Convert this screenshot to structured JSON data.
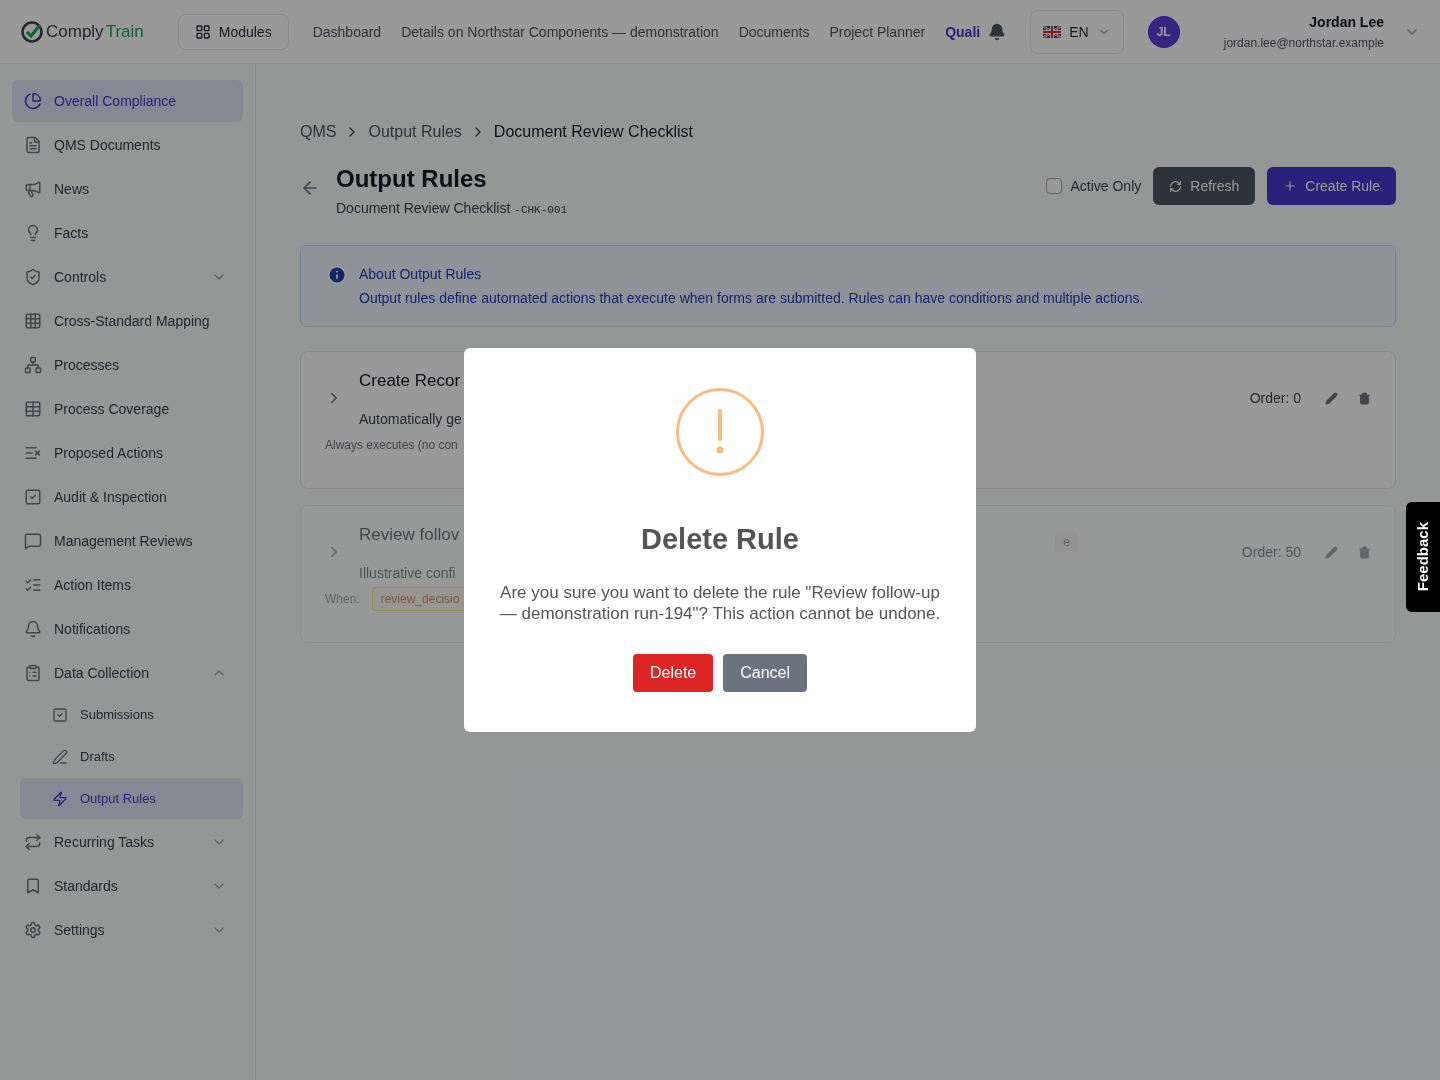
{
  "header": {
    "logo": {
      "part_1": "Comply",
      "part_2": "Train"
    },
    "modules_button": "Modules",
    "nav": [
      {
        "label": "Dashboard",
        "selected": false
      },
      {
        "label": "Details on Northstar Components — demonstration",
        "selected": false
      },
      {
        "label": "Documents",
        "selected": false
      },
      {
        "label": "Project Planner",
        "selected": false
      },
      {
        "label": "Quali",
        "selected": true
      }
    ],
    "language": "EN",
    "user": {
      "initials": "JL",
      "name": "Jordan Lee",
      "email": "jordan.lee@northstar.example"
    }
  },
  "sidebar": {
    "items": [
      {
        "label": "Overall Compliance",
        "selected": true
      },
      {
        "label": "QMS Documents",
        "selected": false
      },
      {
        "label": "News",
        "selected": false
      },
      {
        "label": "Facts",
        "selected": false
      },
      {
        "label": "Controls",
        "selected": false,
        "expanded": false
      },
      {
        "label": "Cross-Standard Mapping",
        "selected": false
      },
      {
        "label": "Processes",
        "selected": false
      },
      {
        "label": "Process Coverage",
        "selected": false
      },
      {
        "label": "Proposed Actions",
        "selected": false
      },
      {
        "label": "Audit & Inspection",
        "selected": false
      },
      {
        "label": "Management Reviews",
        "selected": false
      },
      {
        "label": "Action Items",
        "selected": false
      },
      {
        "label": "Notifications",
        "selected": false
      },
      {
        "label": "Data Collection",
        "selected": false,
        "expanded": true,
        "children": [
          {
            "label": "Submissions",
            "selected": false
          },
          {
            "label": "Drafts",
            "selected": false
          },
          {
            "label": "Output Rules",
            "selected": true
          }
        ]
      },
      {
        "label": "Recurring Tasks",
        "selected": false,
        "expanded": false
      },
      {
        "label": "Standards",
        "selected": false,
        "expanded": false
      },
      {
        "label": "Settings",
        "selected": false,
        "expanded": false
      }
    ]
  },
  "breadcrumb": [
    "QMS",
    "Output Rules",
    "Document Review Checklist"
  ],
  "page": {
    "title": "Output Rules",
    "subtitle": "Document Review Checklist",
    "code": "-CHK-001",
    "active_only": {
      "label": "Active Only",
      "checked": false
    },
    "refresh_button": "Refresh",
    "create_button": "Create Rule"
  },
  "info": {
    "title": "About Output Rules",
    "text": "Output rules define automated actions that execute when forms are submitted. Rules can have conditions and multiple actions."
  },
  "rules": [
    {
      "title": "Create Recor",
      "description": "Automatically ge",
      "active": true,
      "footer": {
        "kind": "note",
        "text": "Always executes (no con"
      },
      "order": "Order: 0"
    },
    {
      "title": "Review follov",
      "description": "Illustrative confi",
      "active": false,
      "tag": "e",
      "footer": {
        "kind": "condition",
        "label": "When:",
        "chip": "review_decisio"
      },
      "order": "Order: 50"
    }
  ],
  "dialog": {
    "title": "Delete Rule",
    "message": "Are you sure you want to delete the rule \"Review follow-up — demonstration run-194\"? This action cannot be undone.",
    "confirm": "Delete",
    "cancel": "Cancel"
  },
  "feedback_tab": "Feedback"
}
